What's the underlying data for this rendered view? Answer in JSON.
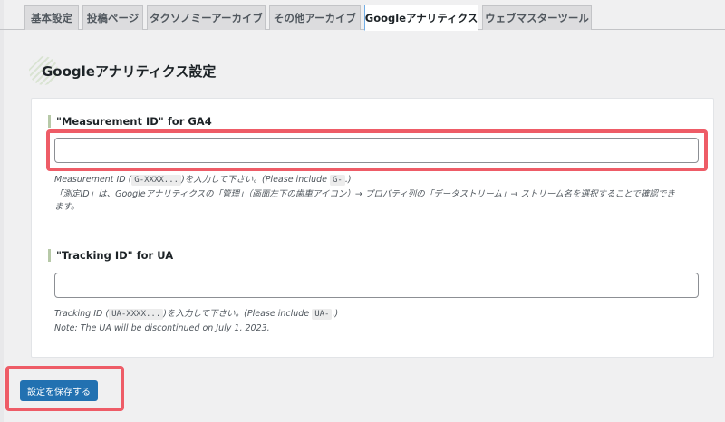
{
  "tabs": [
    {
      "label": "基本設定"
    },
    {
      "label": "投稿ページ"
    },
    {
      "label": "タクソノミーアーカイブ"
    },
    {
      "label": "その他アーカイブ"
    },
    {
      "label": "Googleアナリティクス",
      "active": true
    },
    {
      "label": "ウェブマスターツール"
    }
  ],
  "section": {
    "title": "Googleアナリティクス設定",
    "icon": "leaf-pattern-icon"
  },
  "ga4": {
    "label": "\"Measurement ID\" for GA4",
    "value": "",
    "desc_prefix": "Measurement ID (",
    "desc_code1": "G-XXXX...",
    "desc_mid": ")を入力して下さい。(Please include",
    "desc_code2": "G-",
    "desc_suffix": ".)",
    "desc_line2": "「測定ID」は、Googleアナリティクスの「管理」（画面左下の歯車アイコン）→ プロパティ列の「データストリーム」→ ストリーム名を選択することで確認でき",
    "desc_line3": "ます。"
  },
  "ua": {
    "label": "\"Tracking ID\" for UA",
    "value": "",
    "desc_prefix": "Tracking ID (",
    "desc_code1": "UA-XXXX...",
    "desc_mid": ")を入力して下さい。(Please include",
    "desc_code2": "UA-",
    "desc_suffix": ".)",
    "desc_line2": "Note: The UA will be discontinued on July 1, 2023."
  },
  "save_button": {
    "label": "設定を保存する"
  },
  "colors": {
    "accent": "#2271b1",
    "highlight": "#ee5c67",
    "active_tab_border": "#72aee6"
  }
}
